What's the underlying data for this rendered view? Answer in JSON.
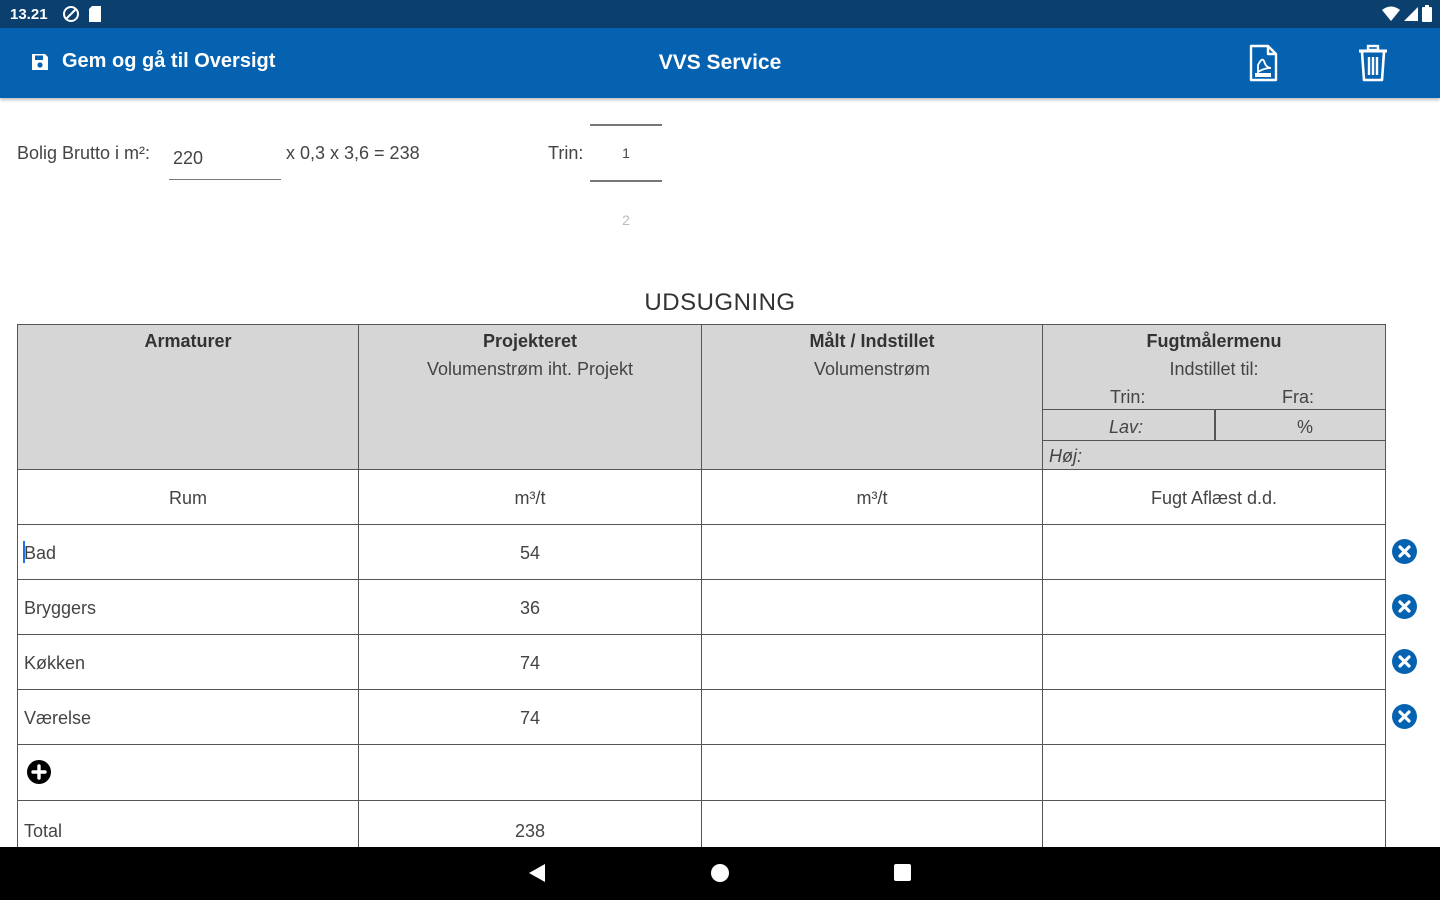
{
  "status_bar": {
    "time": "13.21"
  },
  "app_bar": {
    "save_label": "Gem og gå til Oversigt",
    "title": "VVS Service"
  },
  "form": {
    "bolig_label": "Bolig Brutto i m²:",
    "bolig_value": "220",
    "formula": "x 0,3 x 3,6 = 238",
    "trin_label": "Trin:",
    "trin_selected": "1",
    "trin_next": "2"
  },
  "section_title": "UDSUGNING",
  "table": {
    "headers": {
      "armaturer": "Armaturer",
      "projekteret": "Projekteret",
      "projekteret_sub": "Volumenstrøm iht. Projekt",
      "maalt": "Målt / Indstillet",
      "maalt_sub": "Volumenstrøm",
      "fugt": "Fugtmålermenu",
      "fugt_sub": "Indstillet til:",
      "fugt_trin": "Trin:",
      "fugt_fra": "Fra:",
      "fugt_lav": "Lav:",
      "fugt_pct": "%",
      "fugt_hoj": "Høj:"
    },
    "units": {
      "rum": "Rum",
      "projekteret": "m³/t",
      "maalt": "m³/t",
      "fugt": "Fugt Aflæst d.d."
    },
    "rows": [
      {
        "rum": "Bad",
        "projekteret": "54",
        "maalt": "",
        "fugt": ""
      },
      {
        "rum": "Bryggers",
        "projekteret": "36",
        "maalt": "",
        "fugt": ""
      },
      {
        "rum": "Køkken",
        "projekteret": "74",
        "maalt": "",
        "fugt": ""
      },
      {
        "rum": "Værelse",
        "projekteret": "74",
        "maalt": "",
        "fugt": ""
      }
    ],
    "total_label": "Total",
    "total_projekteret": "238"
  }
}
